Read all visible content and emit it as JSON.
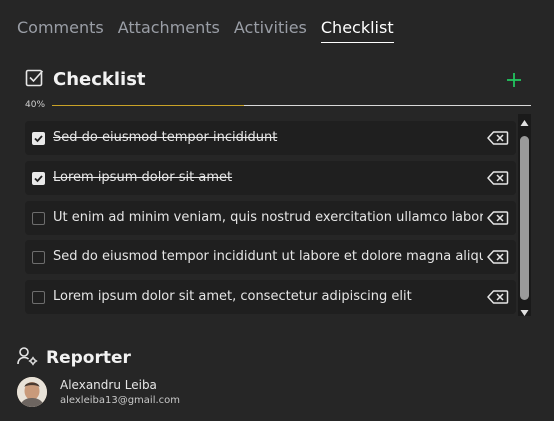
{
  "tabs": [
    {
      "label": "Comments",
      "active": false
    },
    {
      "label": "Attachments",
      "active": false
    },
    {
      "label": "Activities",
      "active": false
    },
    {
      "label": "Checklist",
      "active": true
    }
  ],
  "checklist": {
    "title": "Checklist",
    "add_icon": "plus-icon",
    "progress_label": "40%",
    "progress_value": 0.4,
    "items": [
      {
        "text": "Sed do eiusmod tempor incididunt",
        "checked": true
      },
      {
        "text": "Lorem ipsum dolor sit amet",
        "checked": true
      },
      {
        "text": "Ut enim ad minim veniam, quis nostrud exercitation ullamco laboris",
        "checked": false
      },
      {
        "text": "Sed do eiusmod tempor incididunt ut labore et dolore magna aliqua",
        "checked": false
      },
      {
        "text": "Lorem ipsum dolor sit amet, consectetur adipiscing elit",
        "checked": false
      }
    ]
  },
  "reporter": {
    "title": "Reporter",
    "name": "Alexandru Leiba",
    "email": "alexleiba13@gmail.com"
  },
  "colors": {
    "background": "#262626",
    "item_background": "#1f1f1f",
    "accent_add": "#22c55e",
    "progress_fill": "#c9a227"
  }
}
